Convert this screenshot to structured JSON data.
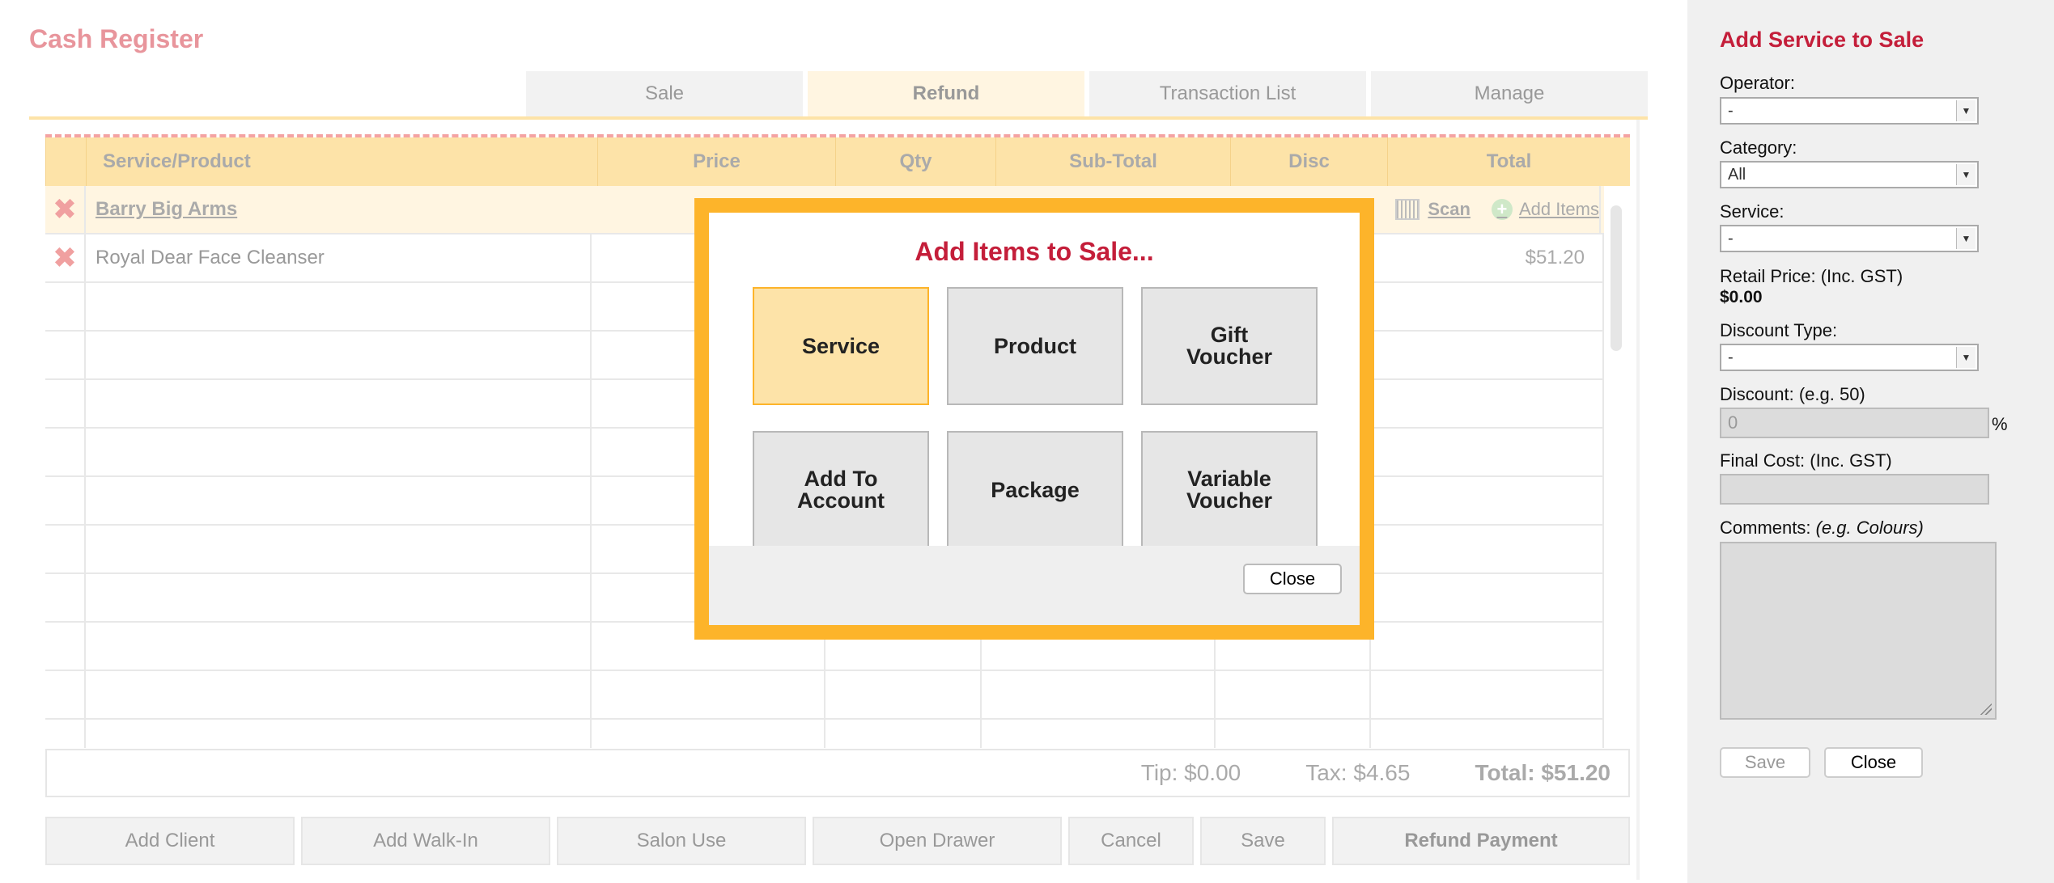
{
  "header": {
    "title": "Cash Register"
  },
  "tabs": [
    {
      "label": "Sale"
    },
    {
      "label": "Refund",
      "active": true
    },
    {
      "label": "Transaction List"
    },
    {
      "label": "Manage"
    }
  ],
  "grid": {
    "columns": [
      "Service/Product",
      "Price",
      "Qty",
      "Sub-Total",
      "Disc",
      "Total"
    ],
    "client": {
      "name": "Barry Big Arms",
      "scan_label": "Scan",
      "add_items_label": "Add Items"
    },
    "rows": [
      {
        "name": "Royal Dear Face Cleanser",
        "total": "$51.20"
      }
    ]
  },
  "totals": {
    "tip": "Tip: $0.00",
    "tax": "Tax: $4.65",
    "total": "Total: $51.20"
  },
  "actions": [
    "Add Client",
    "Add Walk-In",
    "Salon Use",
    "Open Drawer",
    "Cancel",
    "Save",
    "Refund Payment"
  ],
  "modal": {
    "title": "Add Items to Sale...",
    "buttons": [
      "Service",
      "Product",
      "Gift\nVoucher",
      "Add To\nAccount",
      "Package",
      "Variable\nVoucher"
    ],
    "close_label": "Close"
  },
  "sidebar": {
    "title": "Add Service to Sale",
    "operator_label": "Operator:",
    "operator_value": "-",
    "category_label": "Category:",
    "category_value": "All",
    "service_label": "Service:",
    "service_value": "-",
    "retail_label": "Retail Price: (Inc. GST)",
    "retail_value": "$0.00",
    "discount_type_label": "Discount Type:",
    "discount_type_value": "-",
    "discount_label": "Discount: (e.g. 50)",
    "discount_value": "0",
    "discount_unit": "%",
    "final_cost_label": "Final Cost: (Inc. GST)",
    "comments_label": "Comments:",
    "comments_hint": "(e.g. Colours)",
    "save_label": "Save",
    "close_label": "Close"
  },
  "colors": {
    "brand_red": "#c41e3a",
    "accent_orange": "#fdb42a",
    "header_yellow": "#fde3a8"
  }
}
